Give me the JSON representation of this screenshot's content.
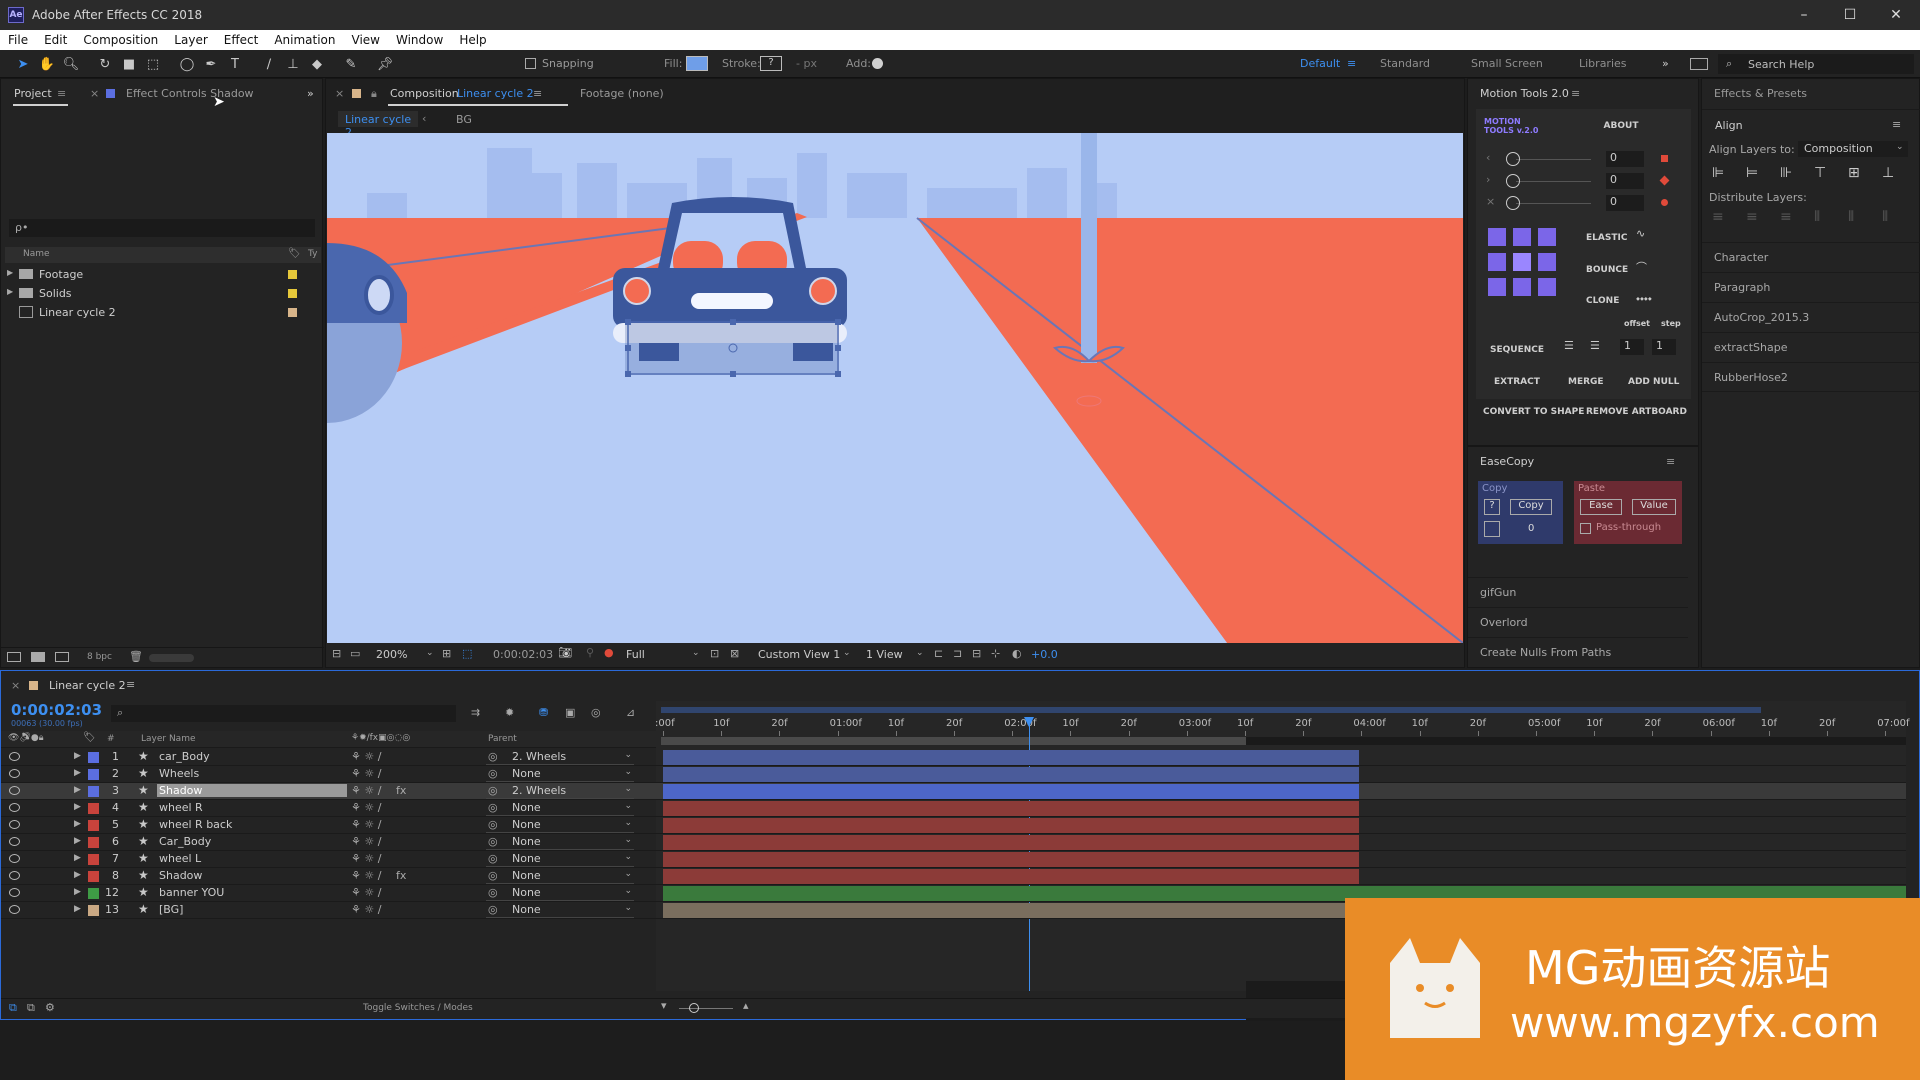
{
  "app": {
    "title": "Adobe After Effects CC 2018",
    "icon": "Ae"
  },
  "window_controls": {
    "minimize": "–",
    "maximize": "☐",
    "close": "✕"
  },
  "menu": [
    "File",
    "Edit",
    "Composition",
    "Layer",
    "Effect",
    "Animation",
    "View",
    "Window",
    "Help"
  ],
  "toolbar": {
    "snapping": "Snapping",
    "fill": "Fill:",
    "stroke": "Stroke:",
    "stroke_val": "?",
    "px": "- px",
    "add": "Add:",
    "workspaces": [
      "Default",
      "Standard",
      "Small Screen",
      "Libraries"
    ],
    "search": "Search Help"
  },
  "project": {
    "tab": "Project",
    "effect_tab": "Effect Controls Shadow",
    "search_placeholder": "ρ•",
    "col_name": "Name",
    "col_type": "Ty",
    "items": [
      {
        "name": "Footage",
        "kind": "folder",
        "label": "#e6c83a"
      },
      {
        "name": "Solids",
        "kind": "folder",
        "label": "#e6c83a"
      },
      {
        "name": "Linear cycle 2",
        "kind": "comp",
        "label": "#d8b58a"
      }
    ],
    "bpc": "8 bpc"
  },
  "viewer": {
    "tab_prefix": "Composition",
    "tab_name": "Linear cycle 2",
    "footage_tab": "Footage  (none)",
    "crumbs": [
      "Linear cycle 2",
      "BG"
    ],
    "zoom": "200%",
    "time": "0:00:02:03",
    "resolution": "Full",
    "view": "Custom View 1",
    "views": "1 View",
    "exposure": "+0.0"
  },
  "motion_tools": {
    "title": "Motion Tools 2.0",
    "logo_line1": "MOTION",
    "logo_line2": "TOOLS v.2.0",
    "about": "ABOUT",
    "slider_values": [
      "0",
      "0",
      "0"
    ],
    "elastic": "ELASTIC",
    "bounce": "BOUNCE",
    "clone": "CLONE",
    "offset": "offset",
    "step": "step",
    "sequence": "SEQUENCE",
    "seq_offset": "1",
    "seq_step": "1",
    "extract": "EXTRACT",
    "merge": "MERGE",
    "add_null": "ADD NULL",
    "convert": "CONVERT TO SHAPE",
    "remove_artboard": "REMOVE ARTBOARD"
  },
  "easecopy": {
    "title": "EaseCopy",
    "copy_label": "Copy",
    "copy_btn": "Copy",
    "q": "?",
    "count": "0",
    "paste_label": "Paste",
    "ease": "Ease",
    "value": "Value",
    "passthrough": "Pass-through"
  },
  "scripts": [
    "gifGun",
    "Overlord",
    "Create Nulls From Paths"
  ],
  "effects": {
    "title": "Effects & Presets",
    "align": "Align",
    "align_to_label": "Align Layers to:",
    "align_to": "Composition",
    "distribute": "Distribute Layers:",
    "items": [
      "Character",
      "Paragraph",
      "AutoCrop_2015.3",
      "extractShape",
      "RubberHose2"
    ]
  },
  "timeline": {
    "comp": "Linear cycle 2",
    "timecode": "0:00:02:03",
    "fps": "00063 (30.00 fps)",
    "col_layer": "Layer Name",
    "col_parent": "Parent",
    "col_num": "#",
    "ruler": [
      ":00f",
      "10f",
      "20f",
      "01:00f",
      "10f",
      "20f",
      "02:00f",
      "10f",
      "20f",
      "03:00f",
      "10f",
      "20f",
      "04:00f",
      "10f",
      "20f",
      "05:00f",
      "10f",
      "20f",
      "06:00f",
      "10f",
      "20f",
      "07:00f"
    ],
    "layers": [
      {
        "num": "1",
        "name": "car_Body",
        "parent": "2. Wheels",
        "label": "#5b6ee0",
        "fx": "",
        "bar": "#4a5b9a"
      },
      {
        "num": "2",
        "name": "Wheels",
        "parent": "None",
        "label": "#5b6ee0",
        "fx": "",
        "bar": "#4a5b9a"
      },
      {
        "num": "3",
        "name": "Shadow",
        "parent": "2. Wheels",
        "label": "#5b6ee0",
        "fx": "fx",
        "bar": "#4d66c8"
      },
      {
        "num": "4",
        "name": "wheel R",
        "parent": "None",
        "label": "#c8433c",
        "fx": "",
        "bar": "#8c3b38"
      },
      {
        "num": "5",
        "name": "wheel R back",
        "parent": "None",
        "label": "#c8433c",
        "fx": "",
        "bar": "#8c3b38"
      },
      {
        "num": "6",
        "name": "Car_Body",
        "parent": "None",
        "label": "#c8433c",
        "fx": "",
        "bar": "#8c3b38"
      },
      {
        "num": "7",
        "name": "wheel L",
        "parent": "None",
        "label": "#c8433c",
        "fx": "",
        "bar": "#8c3b38"
      },
      {
        "num": "8",
        "name": "Shadow",
        "parent": "None",
        "label": "#c8433c",
        "fx": "fx",
        "bar": "#8c3b38"
      },
      {
        "num": "12",
        "name": "banner YOU",
        "parent": "None",
        "label": "#3e9b45",
        "fx": "",
        "bar": "#3a7a3c"
      },
      {
        "num": "13",
        "name": "[BG]",
        "parent": "None",
        "label": "#c9a883",
        "fx": "",
        "bar": "#7a6e5e"
      }
    ],
    "toggle": "Toggle Switches / Modes"
  },
  "watermark": {
    "line1": "MG动画资源站",
    "line2": "www.mgzyfx.com"
  }
}
